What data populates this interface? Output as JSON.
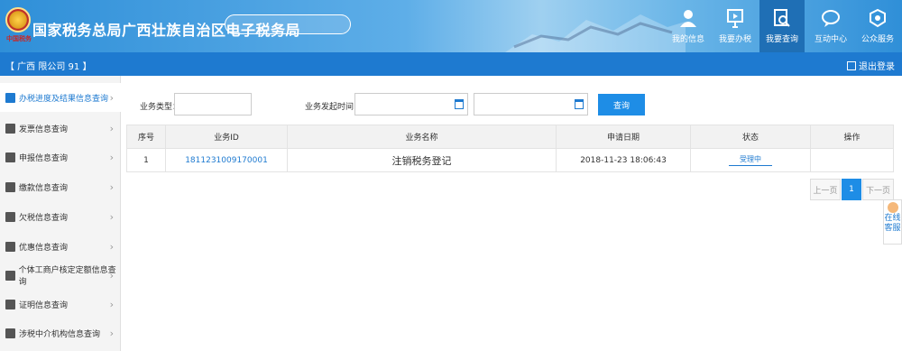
{
  "header": {
    "emblem_text": "中国税务",
    "site_title": "国家税务总局广西壮族自治区电子税务局",
    "nav": [
      {
        "label": "我的信息",
        "icon": "user-icon"
      },
      {
        "label": "我要办税",
        "icon": "monitor-icon"
      },
      {
        "label": "我要查询",
        "icon": "search-doc-icon"
      },
      {
        "label": "互动中心",
        "icon": "chat-icon"
      },
      {
        "label": "公众服务",
        "icon": "service-icon"
      }
    ]
  },
  "subbar": {
    "company": "【 广西                    限公司     91                                    】",
    "logout": "退出登录"
  },
  "sidebar": {
    "items": [
      {
        "label": "办税进度及结果信息查询"
      },
      {
        "label": "发票信息查询"
      },
      {
        "label": "申报信息查询"
      },
      {
        "label": "缴款信息查询"
      },
      {
        "label": "欠税信息查询"
      },
      {
        "label": "优惠信息查询"
      },
      {
        "label": "个体工商户核定定额信息查询"
      },
      {
        "label": "证明信息查询"
      },
      {
        "label": "涉税中介机构信息查询"
      }
    ]
  },
  "filters": {
    "type_label": "业务类型：",
    "time_label": "业务发起时间：",
    "query_button": "查询"
  },
  "table": {
    "headers": [
      "序号",
      "业务ID",
      "业务名称",
      "申请日期",
      "状态",
      "操作"
    ],
    "rows": [
      {
        "index": "1",
        "id": "1811231009170001",
        "name": "注销税务登记",
        "date": "2018-11-23 18:06:43",
        "status": "受理中",
        "action": ""
      }
    ]
  },
  "pager": {
    "prev": "上一页",
    "current": "1",
    "next": "下一页"
  },
  "online_service": {
    "line1": "在线",
    "line2": "客服"
  },
  "colors": {
    "primary": "#1e7ad0",
    "button": "#1e8de6"
  }
}
